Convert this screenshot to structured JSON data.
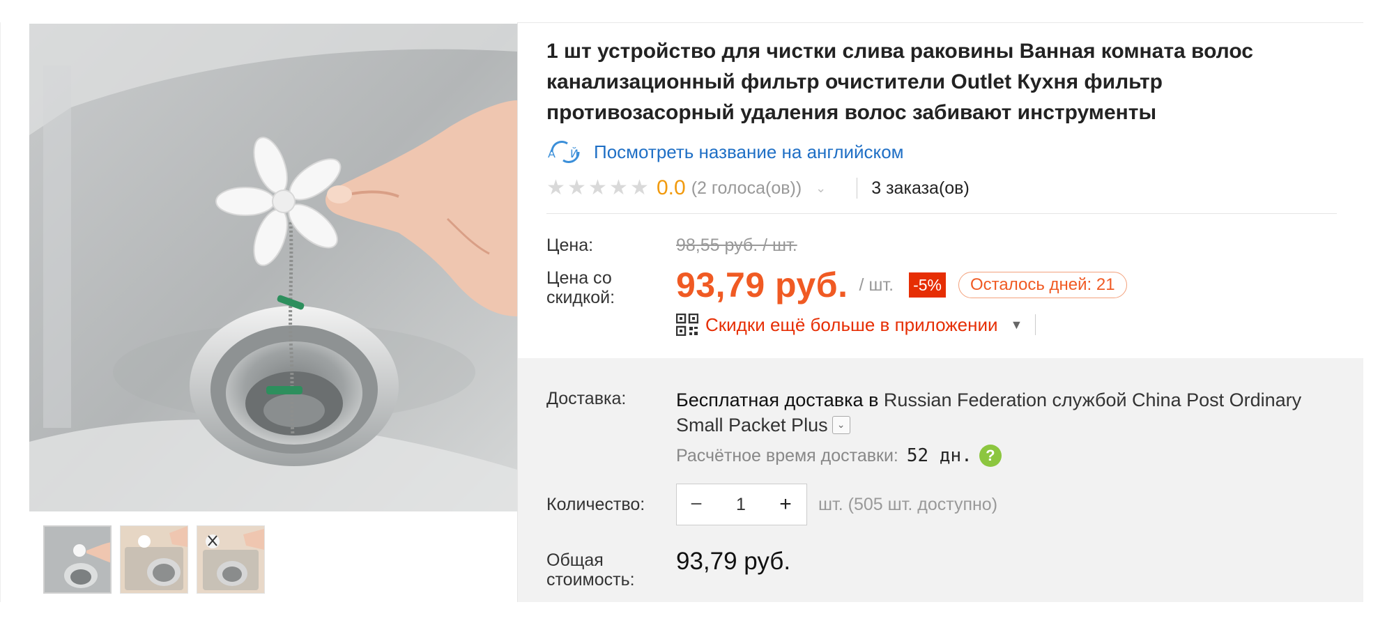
{
  "product": {
    "title": "1 шт устройство для чистки слива раковины Ванная комната волос канализационный фильтр очистители Outlet Кухня фильтр противозасорный удаления волос забивают инструменты",
    "translate_link": "Посмотреть название на английском",
    "rating_value": "0.0",
    "votes": "(2 голоса(ов))",
    "orders": "3 заказа(ов)"
  },
  "pricing": {
    "price_label": "Цена:",
    "price_old": "98,55 руб. / шт.",
    "discount_label_line1": "Цена со",
    "discount_label_line2": "скидкой:",
    "price_now": "93,79 руб.",
    "per_unit": "/ шт.",
    "discount_badge": "-5%",
    "days_left": "Осталось дней: 21",
    "app_promo": "Скидки ещё больше в приложении"
  },
  "shipping": {
    "label": "Доставка:",
    "free_text": "Бесплатная доставка в",
    "destination_text": " Russian Federation службой China Post Ordinary Small Packet Plus",
    "eta_label": "Расчётное время доставки:",
    "eta_value": "52 дн.",
    "help": "?"
  },
  "quantity": {
    "label": "Количество:",
    "minus": "−",
    "value": "1",
    "plus": "+",
    "available": "шт. (505 шт. доступно)"
  },
  "total": {
    "label_line1": "Общая",
    "label_line2": "стоимость:",
    "value": "93,79 руб."
  },
  "gallery": {
    "thumbnails": [
      "thumbnail-1",
      "thumbnail-2",
      "thumbnail-3"
    ],
    "active_index": 0
  },
  "colors": {
    "price_orange": "#f05a23",
    "rating_orange": "#f19a0e",
    "discount_red": "#e62e04",
    "link_blue": "#1f6fc5",
    "help_green": "#8cc63f"
  },
  "icons": [
    "translate-icon",
    "star-icon",
    "chevron-down-icon",
    "qr-code-icon",
    "caret-down-icon",
    "help-icon",
    "minus-icon",
    "plus-icon"
  ]
}
